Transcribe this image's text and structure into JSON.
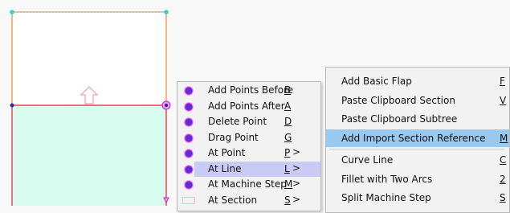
{
  "colors": {
    "top_rect": "#f2a05a",
    "bottom_rect": "#e84553",
    "fill": "#d8fcef",
    "vertex_cyan": "#35d3c9",
    "vertex_blue": "#2234b5",
    "vertex_magenta": "#c21fcf",
    "arrow": "#f0a0a8",
    "menu_bg": "#f2f2f2",
    "menu_highlight_1": "#c9cbf4",
    "menu_highlight_2": "#99c9ef"
  },
  "canvas": {
    "icons": [
      "vertex-handle-icon",
      "up-arrow-icon"
    ]
  },
  "point_menu": {
    "items": [
      {
        "label": "Add Points Before",
        "key": "B",
        "arrow": "",
        "bullet": true
      },
      {
        "label": "Add Points After",
        "key": "A",
        "arrow": "",
        "bullet": true
      },
      {
        "label": "Delete Point",
        "key": "D",
        "arrow": "",
        "bullet": true
      },
      {
        "label": "Drag Point",
        "key": "G",
        "arrow": "",
        "bullet": true
      },
      {
        "label": "At Point",
        "key": "P",
        "arrow": ">",
        "bullet": true
      },
      {
        "label": "At Line",
        "key": "L",
        "arrow": ">",
        "bullet": true
      },
      {
        "label": "At Machine Step",
        "key": "M",
        "arrow": ">",
        "bullet": true
      },
      {
        "label": "At Section",
        "key": "S",
        "arrow": ">",
        "bullet": false
      }
    ],
    "highlighted_index": 5
  },
  "line_submenu": {
    "items": [
      {
        "label": "Add Basic Flap",
        "key": "F"
      },
      {
        "label": "Paste Clipboard Section",
        "key": "V"
      },
      {
        "label": "Paste Clipboard Subtree",
        "key": ""
      },
      {
        "label": "Add Import Section Reference",
        "key": "M"
      },
      {
        "label": "Curve Line",
        "key": "C"
      },
      {
        "label": "Fillet with Two Arcs",
        "key": "2"
      },
      {
        "label": "Split Machine Step",
        "key": "S"
      }
    ],
    "highlighted_index": 3,
    "separator_after_index": 3
  }
}
